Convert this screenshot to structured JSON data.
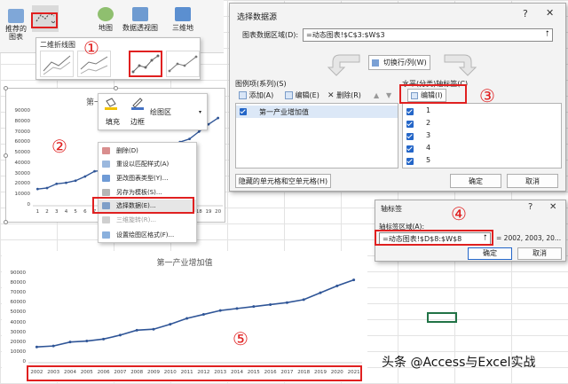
{
  "ribbon": {
    "recommended_chart_label": "推荐的\n图表",
    "map_label": "地图",
    "pivot_chart_label": "数据透视图",
    "three_d_label": "三维地",
    "gallery_title": "二维折线图"
  },
  "chart1": {
    "title": "第一",
    "y_ticks": [
      "90000",
      "80000",
      "70000",
      "60000",
      "50000",
      "40000",
      "30000",
      "20000",
      "10000",
      "0"
    ],
    "x_ticks": [
      "1",
      "2",
      "3",
      "4",
      "5",
      "6",
      "7",
      "8",
      "9",
      "10",
      "11",
      "12",
      "13",
      "14",
      "15",
      "16",
      "17",
      "18",
      "19",
      "20"
    ]
  },
  "mini_toolbar": {
    "fill_label": "填充",
    "border_label": "边框",
    "area_select": "绘图区"
  },
  "context_menu": {
    "items": [
      "删除(D)",
      "重设以匹配样式(A)",
      "更改图表类型(Y)...",
      "另存为模板(S)...",
      "选择数据(E)...",
      "三维旋转(R)...",
      "设置绘图区格式(F)..."
    ]
  },
  "select_data_dialog": {
    "title": "选择数据源",
    "range_label": "图表数据区域(D):",
    "range_value": "=动态图表!$C$3:$W$3",
    "switch_button": "切换行/列(W)",
    "series_header": "图例项(系列)(S)",
    "add_button": "添加(A)",
    "edit_button": "编辑(E)",
    "delete_button": "删除(R)",
    "series_items": [
      "第一产业增加值"
    ],
    "axis_header": "水平(分类)轴标签(C)",
    "axis_edit_button": "编辑(I)",
    "axis_items": [
      "1",
      "2",
      "3",
      "4",
      "5"
    ],
    "hidden_button": "隐藏的单元格和空单元格(H)",
    "ok": "确定",
    "cancel": "取消"
  },
  "axis_dialog": {
    "title": "轴标签",
    "range_label": "轴标签区域(A):",
    "range_value": "=动态图表!$D$8:$W$8",
    "preview": "= 2002, 2003, 20...",
    "ok": "确定",
    "cancel": "取消"
  },
  "steps": [
    "①",
    "②",
    "③",
    "④",
    "⑤"
  ],
  "watermark": "头条 @Access与Excel实战",
  "chart_data": [
    {
      "type": "line",
      "title": "第一",
      "x": [
        1,
        2,
        3,
        4,
        5,
        6,
        7,
        8,
        9,
        10,
        11,
        12,
        13,
        14,
        15,
        16,
        17,
        18,
        19,
        20
      ],
      "values": [
        16000,
        17000,
        21000,
        22000,
        24000,
        28000,
        33000,
        34000,
        39000,
        45000,
        49000,
        53000,
        55000,
        57000,
        59000,
        61000,
        64000,
        71000,
        78000,
        84000
      ],
      "ylim": [
        0,
        90000
      ]
    },
    {
      "type": "line",
      "title": "第一产业增加值",
      "x": [
        "2002",
        "2003",
        "2004",
        "2005",
        "2006",
        "2007",
        "2008",
        "2009",
        "2010",
        "2011",
        "2012",
        "2013",
        "2014",
        "2015",
        "2016",
        "2017",
        "2018",
        "2019",
        "2020",
        "2021"
      ],
      "values": [
        16000,
        17000,
        21000,
        22000,
        24000,
        28000,
        33000,
        34000,
        39000,
        45000,
        49000,
        53000,
        55000,
        57000,
        59000,
        61000,
        64000,
        71000,
        78000,
        84000
      ],
      "ylim": [
        0,
        90000
      ]
    }
  ],
  "colors": {
    "line": "#2f5597",
    "accent_red": "#e02020",
    "checkbox": "#2466c8",
    "selection": "#217346"
  }
}
